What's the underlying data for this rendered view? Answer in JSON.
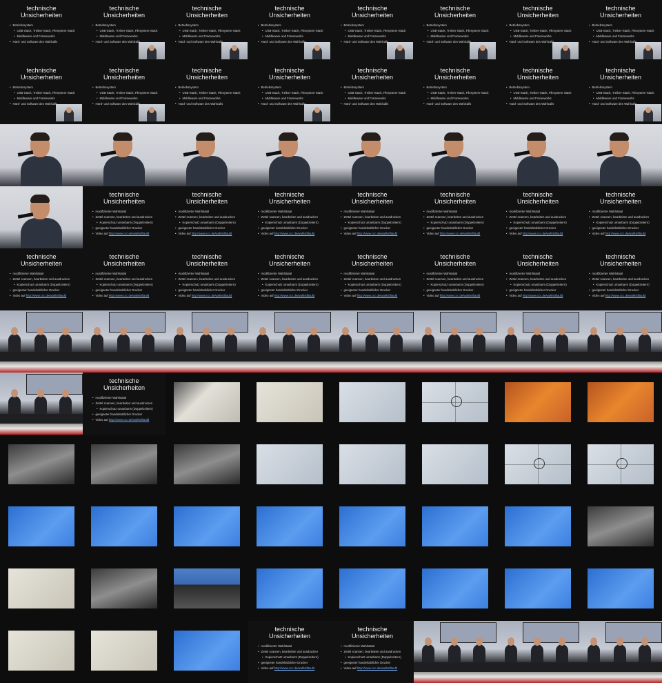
{
  "slides": {
    "a": {
      "title": [
        "technische",
        "Unsicherheiten"
      ],
      "items": [
        {
          "text": "Betriebssystem",
          "sub": false
        },
        {
          "text": "USB-Stack, Treiber-Stack, Filesystem-Stack",
          "sub": true
        },
        {
          "text": "Middleware und Frameworks",
          "sub": true
        },
        {
          "text": "Hard- und Software des Wahlcalls",
          "sub": false
        }
      ]
    },
    "b": {
      "title": [
        "technische",
        "Unsicherheiten"
      ],
      "items": [
        {
          "text": "modifizierter Wahlstatal",
          "sub": false
        },
        {
          "text": "Zettel scannen, bearbeiten und ausdrucken",
          "sub": false
        },
        {
          "text": "Kopierschutz umanbarm (Doppelzeitern)",
          "sub": true
        },
        {
          "text": "geeigneter handelsüblicher Drucker",
          "sub": false
        },
        {
          "text": "Video auf ",
          "sub": false,
          "link": "http://www.ccc.de/wahlstiftaufd"
        }
      ]
    }
  },
  "rows": [
    [
      "a",
      "a-pip",
      "a-pip",
      "a-pip",
      "a-pip",
      "a-pip",
      "a-pip",
      "a-pip"
    ],
    [
      "a-pip",
      "a-pip",
      "a",
      "a-pip",
      "a",
      "a",
      "a",
      "a-pip"
    ],
    [
      "speaker",
      "speaker",
      "speaker",
      "speaker",
      "speaker",
      "speaker",
      "speaker",
      "speaker"
    ],
    [
      "speaker",
      "b",
      "b",
      "b",
      "b",
      "b",
      "b",
      "b"
    ],
    [
      "b",
      "b",
      "b",
      "b",
      "b",
      "b",
      "b",
      "b"
    ],
    [
      "panel",
      "panel",
      "panel",
      "panel",
      "panel",
      "panel",
      "panel",
      "panel"
    ],
    [
      "panel",
      "b",
      "paper-dark",
      "paper",
      "lcd",
      "lcd-circle",
      "orange",
      "orange"
    ],
    [
      "desk-pic",
      "desk-pic",
      "desk-pic",
      "lcd",
      "lcd",
      "lcd",
      "lcd-circle",
      "lcd-circle"
    ],
    [
      "bluescr",
      "bluescr",
      "bluescr",
      "bluescr",
      "bluescr",
      "bluescr",
      "bluescr",
      "desk-pic"
    ],
    [
      "paper",
      "desk-pic",
      "laptop",
      "bluescr",
      "bluescr",
      "bluescr",
      "bluescr",
      "bluescr"
    ],
    [
      "paper",
      "paper",
      "bluescr",
      "b",
      "b",
      "panel",
      "panel",
      "panel"
    ]
  ]
}
